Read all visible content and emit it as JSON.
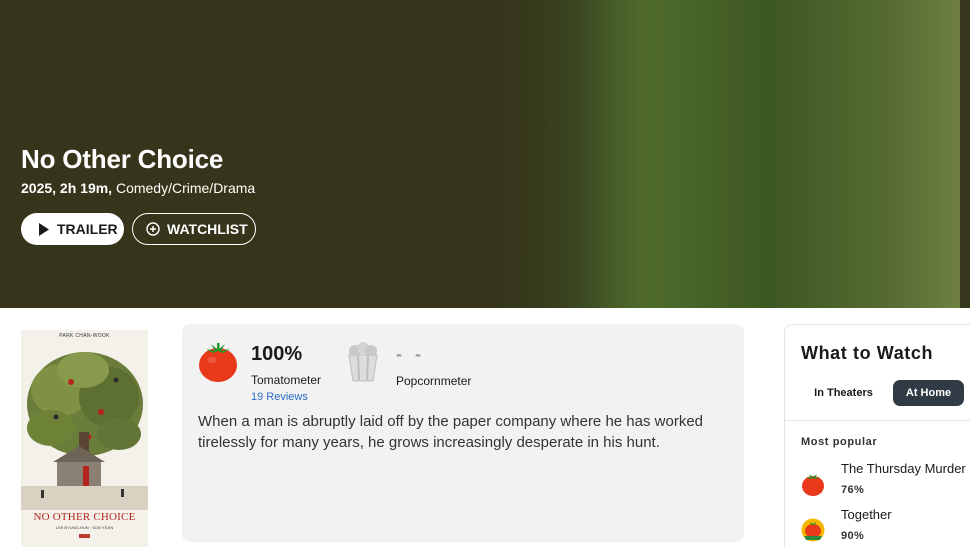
{
  "hero": {
    "title": "No Other Choice",
    "year_runtime": "2025, 2h 19m,",
    "genres": "Comedy/Crime/Drama",
    "trailer_label": "TRAILER",
    "watchlist_label": "WATCHLIST"
  },
  "poster": {
    "director_credit": "PARK CHAN-WOOK",
    "title": "NO OTHER CHOICE",
    "cast": "LEE BYUNG-HUN · SON YEJIN"
  },
  "scores": {
    "tomatometer": "100%",
    "tomatometer_label": "Tomatometer",
    "reviews": "19 Reviews",
    "popcornmeter": "- -",
    "popcornmeter_label": "Popcornmeter"
  },
  "synopsis": "When a man is abruptly laid off by the paper company where he has worked tirelessly for many years, he grows increasingly desperate in his hunt.",
  "what_to_watch": {
    "title": "What to Watch",
    "tabs": [
      {
        "label": "In Theaters",
        "active": false
      },
      {
        "label": "At Home",
        "active": true
      }
    ],
    "section": "Most popular",
    "items": [
      {
        "title": "The Thursday Murder Club",
        "score": "76%",
        "icon": "fresh-tomato-icon"
      },
      {
        "title": "Together",
        "score": "90%",
        "icon": "certified-fresh-icon"
      }
    ]
  },
  "colors": {
    "hero_bg": "#36351b",
    "tomato_red": "#e8391b",
    "link_blue": "#2a6cc7",
    "active_tab": "#2f3a45"
  }
}
